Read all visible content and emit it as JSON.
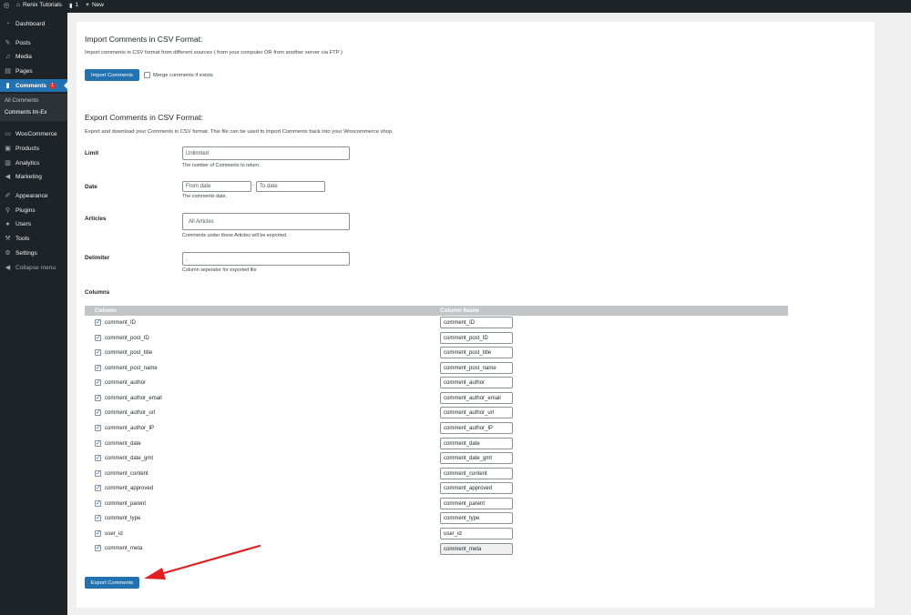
{
  "adminbar": {
    "site_name": "Renix Tutorials",
    "comments_count": "1",
    "new_label": "New"
  },
  "sidebar": {
    "items": [
      {
        "label": "Dashboard",
        "icon": "dashboard-icon"
      },
      {
        "label": "Posts",
        "icon": "pin-icon"
      },
      {
        "label": "Media",
        "icon": "media-icon"
      },
      {
        "label": "Pages",
        "icon": "pages-icon"
      },
      {
        "label": "Comments",
        "icon": "comment-icon",
        "badge": "1"
      },
      {
        "label": "WooCommerce",
        "icon": "woocommerce-icon"
      },
      {
        "label": "Products",
        "icon": "products-icon"
      },
      {
        "label": "Analytics",
        "icon": "analytics-icon"
      },
      {
        "label": "Marketing",
        "icon": "marketing-icon"
      },
      {
        "label": "Appearance",
        "icon": "appearance-icon"
      },
      {
        "label": "Plugins",
        "icon": "plugins-icon"
      },
      {
        "label": "Users",
        "icon": "users-icon"
      },
      {
        "label": "Tools",
        "icon": "tools-icon"
      },
      {
        "label": "Settings",
        "icon": "settings-icon"
      },
      {
        "label": "Collapse menu",
        "icon": "collapse-icon"
      }
    ],
    "submenu": [
      {
        "label": "All Comments"
      },
      {
        "label": "Comments Im-Ex"
      }
    ]
  },
  "import": {
    "title": "Import Comments in CSV Format:",
    "description": "Import comments in CSV format from different sources ( from your computer OR from another server via FTP )",
    "button": "Import Comments",
    "merge_label": "Merge comments if exists"
  },
  "export": {
    "title": "Export Comments in CSV Format:",
    "description": "Export and download your Comments in CSV format. This file can be used to import Comments back into your Woocommerce shop.",
    "limit": {
      "label": "Limit",
      "value": "Unlimited",
      "help": "The number of Comments to return."
    },
    "date": {
      "label": "Date",
      "from_placeholder": "From date",
      "separator": "-",
      "to_placeholder": "To date",
      "help": "The comments date."
    },
    "articles": {
      "label": "Articles",
      "placeholder": "All Articles",
      "help": "Comments under these Articles will be exported."
    },
    "delimiter": {
      "label": "Delimiter",
      "value": ",",
      "help": "Column seperator for exported file"
    },
    "columns_label": "Columns",
    "table_headers": {
      "column": "Column",
      "column_name": "Column Name"
    },
    "columns": [
      {
        "field": "comment_ID",
        "name": "comment_ID"
      },
      {
        "field": "comment_post_ID",
        "name": "comment_post_ID"
      },
      {
        "field": "comment_post_title",
        "name": "comment_post_title"
      },
      {
        "field": "comment_post_name",
        "name": "comment_post_name"
      },
      {
        "field": "comment_author",
        "name": "comment_author"
      },
      {
        "field": "comment_author_email",
        "name": "comment_author_email"
      },
      {
        "field": "comment_author_url",
        "name": "comment_author_url"
      },
      {
        "field": "comment_author_IP",
        "name": "comment_author_IP"
      },
      {
        "field": "comment_date",
        "name": "comment_date"
      },
      {
        "field": "comment_date_gmt",
        "name": "comment_date_gmt"
      },
      {
        "field": "comment_content",
        "name": "comment_content"
      },
      {
        "field": "comment_approved",
        "name": "comment_approved"
      },
      {
        "field": "comment_parent",
        "name": "comment_parent"
      },
      {
        "field": "comment_type",
        "name": "comment_type"
      },
      {
        "field": "user_id",
        "name": "user_id"
      },
      {
        "field": "comment_meta",
        "name": "comment_meta"
      }
    ],
    "button": "Export Comments"
  },
  "colors": {
    "admin_dark": "#1d2327",
    "accent": "#2271b1",
    "annotation_arrow": "#e02020"
  }
}
